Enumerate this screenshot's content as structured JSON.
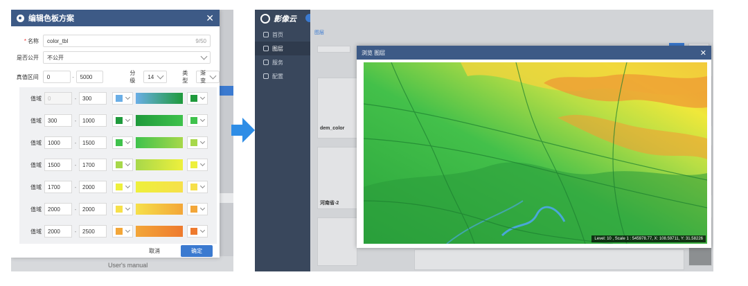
{
  "left": {
    "dialog_title": "编辑色板方案",
    "close_glyph": "✕",
    "name_label": "名称",
    "name_value": "color_tbl",
    "name_count": "9/50",
    "public_label": "是否公开",
    "public_value": "不公开",
    "range_label": "真值区间",
    "range_min": "0",
    "range_max": "5000",
    "level_label": "分级",
    "level_value": "14",
    "type_label": "类型",
    "type_value": "渐变",
    "row_label": "值域",
    "rows": [
      {
        "from": "0",
        "to": "300",
        "c1": "#6aaee6",
        "c2": "#1f9a3c",
        "g1": "#6aaee6",
        "g2": "#1f9a3c",
        "disabled": true
      },
      {
        "from": "300",
        "to": "1000",
        "c1": "#1f9a3c",
        "c2": "#3fc24c",
        "g1": "#1f9a3c",
        "g2": "#3fc24c",
        "disabled": false
      },
      {
        "from": "1000",
        "to": "1500",
        "c1": "#3fc24c",
        "c2": "#a7d84a",
        "g1": "#3fc24c",
        "g2": "#a7d84a",
        "disabled": false
      },
      {
        "from": "1500",
        "to": "1700",
        "c1": "#a7d84a",
        "c2": "#eef03c",
        "g1": "#a7d84a",
        "g2": "#eef03c",
        "disabled": false
      },
      {
        "from": "1700",
        "to": "2000",
        "c1": "#eef03c",
        "c2": "#f6e04a",
        "g1": "#eef03c",
        "g2": "#f6e04a",
        "disabled": false
      },
      {
        "from": "2000",
        "to": "2000",
        "c1": "#f6e04a",
        "c2": "#f3a638",
        "g1": "#f6e04a",
        "g2": "#f3a638",
        "disabled": false
      },
      {
        "from": "2000",
        "to": "2500",
        "c1": "#f3a638",
        "c2": "#ee7a2e",
        "g1": "#f3a638",
        "g2": "#ee7a2e",
        "disabled": false
      }
    ],
    "cancel_label": "取消",
    "ok_label": "确定",
    "bg_manual": "User's manual"
  },
  "right": {
    "app_name": "影像云",
    "nav": [
      {
        "label": "首页",
        "active": false
      },
      {
        "label": "图层",
        "active": true
      },
      {
        "label": "服务",
        "active": false
      },
      {
        "label": "配置",
        "active": false
      }
    ],
    "tab_label": "图层",
    "card_label_1": "dem_color",
    "card_label_2": "河南省-2",
    "map_title": "浏览 图层",
    "map_close": "✕",
    "status_text": "Level: 10 , Scale 1 : 545978.77, X: 108.59711, Y: 31.58226"
  },
  "colors": {
    "header": "#3d5a86",
    "accent": "#3b7ad0",
    "arrow": "#2e8de6",
    "sidebar": "#39475c"
  }
}
